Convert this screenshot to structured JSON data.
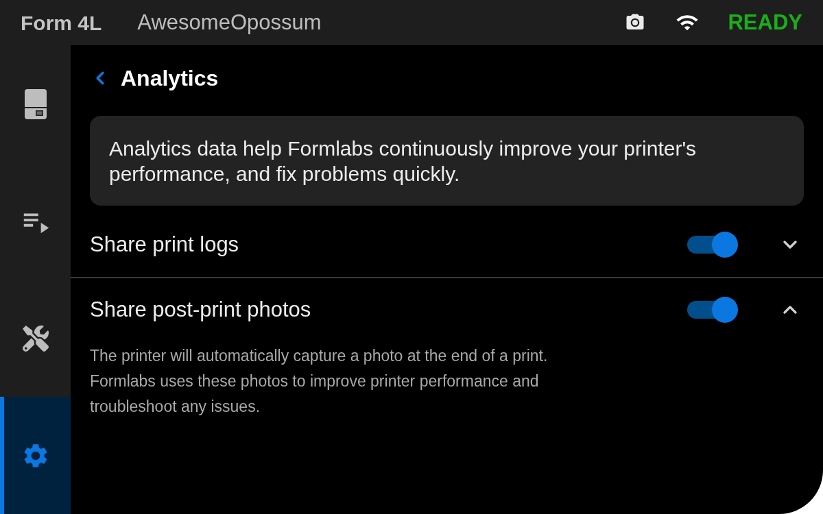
{
  "top_bar": {
    "model": "Form 4L",
    "printer_name": "AwesomeOpossum",
    "status": "READY"
  },
  "sidebar": {
    "items": [
      {
        "kind": "printer",
        "selected": false
      },
      {
        "kind": "queue",
        "selected": false
      },
      {
        "kind": "tools",
        "selected": false
      },
      {
        "kind": "settings",
        "selected": true
      }
    ]
  },
  "page": {
    "title": "Analytics",
    "intro": "Analytics data help Formlabs continuously improve your printer's performance, and fix problems quickly.",
    "settings": [
      {
        "label": "Share print logs",
        "on": true,
        "expanded": false
      },
      {
        "label": "Share post-print photos",
        "on": true,
        "expanded": true,
        "description": "The printer will automatically capture a photo at the end of a print. Formlabs uses these photos to improve printer performance and troubleshoot any issues."
      }
    ]
  }
}
